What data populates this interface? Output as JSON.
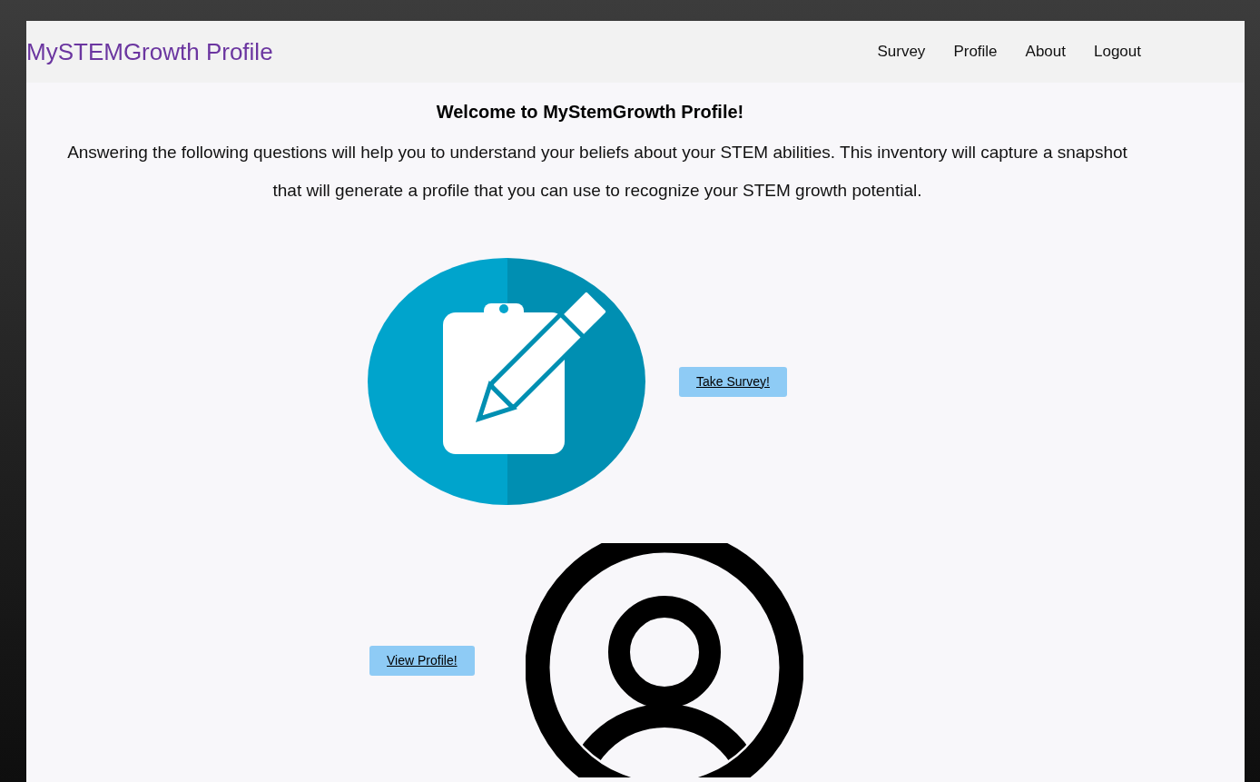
{
  "brand": "MySTEMGrowth Profile",
  "nav": [
    {
      "label": "Survey"
    },
    {
      "label": "Profile"
    },
    {
      "label": "About"
    },
    {
      "label": "Logout"
    }
  ],
  "welcome": "Welcome to MyStemGrowth Profile!",
  "intro": "Answering the following questions will help you to understand your beliefs about your STEM abilities. This inventory will capture a snapshot that will generate a profile that you can use to recognize your STEM growth potential.",
  "actions": [
    {
      "kind": "survey",
      "button": "Take Survey!"
    },
    {
      "kind": "profile",
      "button": "View Profile!"
    }
  ]
}
